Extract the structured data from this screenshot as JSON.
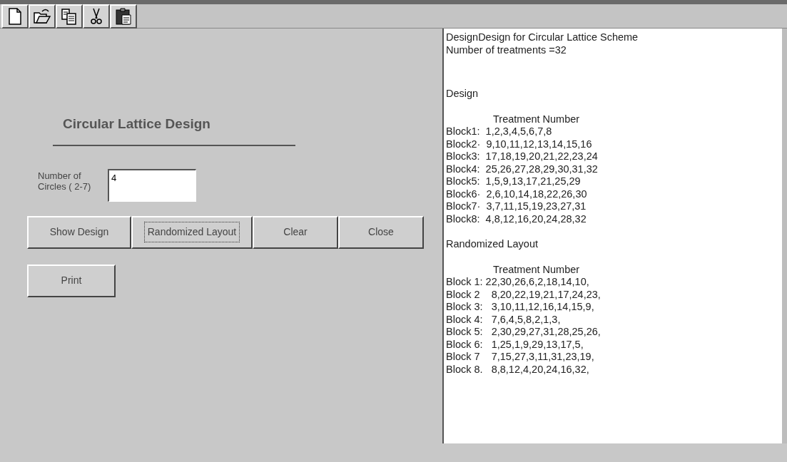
{
  "toolbar": [
    {
      "kind": "new"
    },
    {
      "kind": "open"
    },
    {
      "kind": "copy"
    },
    {
      "kind": "cut"
    },
    {
      "kind": "paste"
    }
  ],
  "form": {
    "title": "Circular Lattice Design",
    "circles": {
      "label": "Number of Circles ( 2-7)",
      "value": "4"
    },
    "buttons": [
      {
        "label": "Show Design",
        "focused": false
      },
      {
        "label": "Randomized Layout",
        "focused": true
      },
      {
        "label": "Clear",
        "focused": false
      },
      {
        "label": "Close",
        "focused": false
      }
    ],
    "print_button": {
      "label": "Print",
      "focused": false
    }
  },
  "output": {
    "sections": [
      {
        "lines": [
          {
            "kind": "text",
            "text": "DesignDesign for Circular Lattice Scheme"
          },
          {
            "kind": "text",
            "text": "Number of treatments =32"
          }
        ]
      },
      {
        "lines": [
          {
            "kind": "text",
            "text": "Design"
          }
        ]
      },
      {
        "lines": [
          {
            "kind": "header",
            "text": "Treatment Number"
          },
          {
            "kind": "text",
            "text": "Block1:  1,2,3,4,5,6,7,8"
          },
          {
            "kind": "text",
            "text": "Block2·  9,10,11,12,13,14,15,16"
          },
          {
            "kind": "text",
            "text": "Block3:  17,18,19,20,21,22,23,24"
          },
          {
            "kind": "text",
            "text": "Block4:  25,26,27,28,29,30,31,32"
          },
          {
            "kind": "text",
            "text": "Block5:  1,5,9,13,17,21,25,29"
          },
          {
            "kind": "text",
            "text": "Block6·  2,6,10,14,18,22,26,30"
          },
          {
            "kind": "text",
            "text": "Block7·  3,7,11,15,19,23,27,31"
          },
          {
            "kind": "text",
            "text": "Block8:  4,8,12,16,20,24,28,32"
          }
        ]
      },
      {
        "lines": [
          {
            "kind": "text",
            "text": "Randomized Layout"
          }
        ]
      },
      {
        "lines": [
          {
            "kind": "header",
            "text": "Treatment Number"
          },
          {
            "kind": "text",
            "text": "Block 1: 22,30,26,6,2,18,14,10,"
          },
          {
            "kind": "text",
            "text": "Block 2    8,20,22,19,21,17,24,23,"
          },
          {
            "kind": "text",
            "text": "Block 3:   3,10,11,12,16,14,15,9,"
          },
          {
            "kind": "text",
            "text": "Block 4:   7,6,4,5,8,2,1,3,"
          },
          {
            "kind": "text",
            "text": "Block 5:   2,30,29,27,31,28,25,26,"
          },
          {
            "kind": "text",
            "text": "Block 6:   1,25,1,9,29,13,17,5,"
          },
          {
            "kind": "text",
            "text": "Block 7    7,15,27,3,11,31,23,19,"
          },
          {
            "kind": "text",
            "text": "Block 8.   8,8,12,4,20,24,16,32,"
          }
        ]
      }
    ]
  }
}
